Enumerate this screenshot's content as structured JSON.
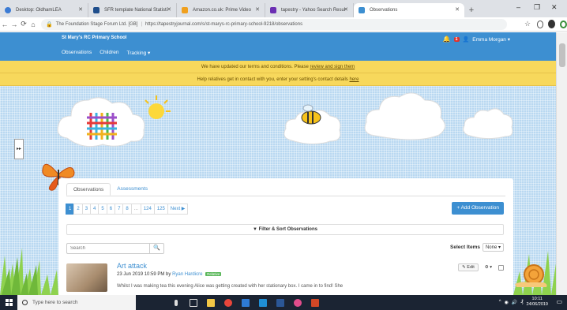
{
  "browser": {
    "tabs": [
      {
        "label": "Desktop: OldhamLEA",
        "color": "#3b7bd4"
      },
      {
        "label": "SFR template National Statisti",
        "color": "#1f4e8c"
      },
      {
        "label": "Amazon.co.uk: Prime Video",
        "color": "#f0a01e"
      },
      {
        "label": "tapestry - Yahoo Search Resul",
        "color": "#6b2fb3"
      },
      {
        "label": "Observations",
        "color": "#3d8fd1"
      }
    ],
    "address": {
      "site_info": "The Foundation Stage Forum Ltd. [GB]",
      "url": "https://tapestryjournal.com/s/st-marys-rc-primary-school-9218/observations"
    }
  },
  "site": {
    "school_name": "St Mary's RC Primary School",
    "nav": [
      "Observations",
      "Children",
      "Tracking ▾"
    ],
    "notification_count": "1",
    "user_name": "Emma Morgan ▾"
  },
  "notices": {
    "terms_text": "We have updated our terms and conditions. Please",
    "terms_link": "review and sign them",
    "contact_text": "Help relatives get in contact with you, enter your setting's contact details",
    "contact_link": "here"
  },
  "content": {
    "tabs": [
      "Observations",
      "Assessments"
    ],
    "pagination": [
      "1",
      "2",
      "3",
      "4",
      "5",
      "6",
      "7",
      "8",
      "...",
      "124",
      "125",
      "Next ▶"
    ],
    "add_observation": "+ Add Observation",
    "filter_sort": "▼ Filter & Sort Observations",
    "search_placeholder": "Search",
    "select_items_label": "Select Items",
    "select_items_value": "None ▾",
    "observation": {
      "title": "Art attack",
      "date": "23 Jun 2019 10:59 PM by",
      "author": "Ryan Hardicre",
      "status_badge": "Relative",
      "excerpt": "Whilst I was making tea this evening Alice was getting created with her stationary box. I came in to find! She",
      "edit_label": "✎ Edit",
      "options_label": "⚙ ▾"
    }
  },
  "taskbar": {
    "search_placeholder": "Type here to search",
    "time": "10:11",
    "date": "24/06/2019"
  }
}
